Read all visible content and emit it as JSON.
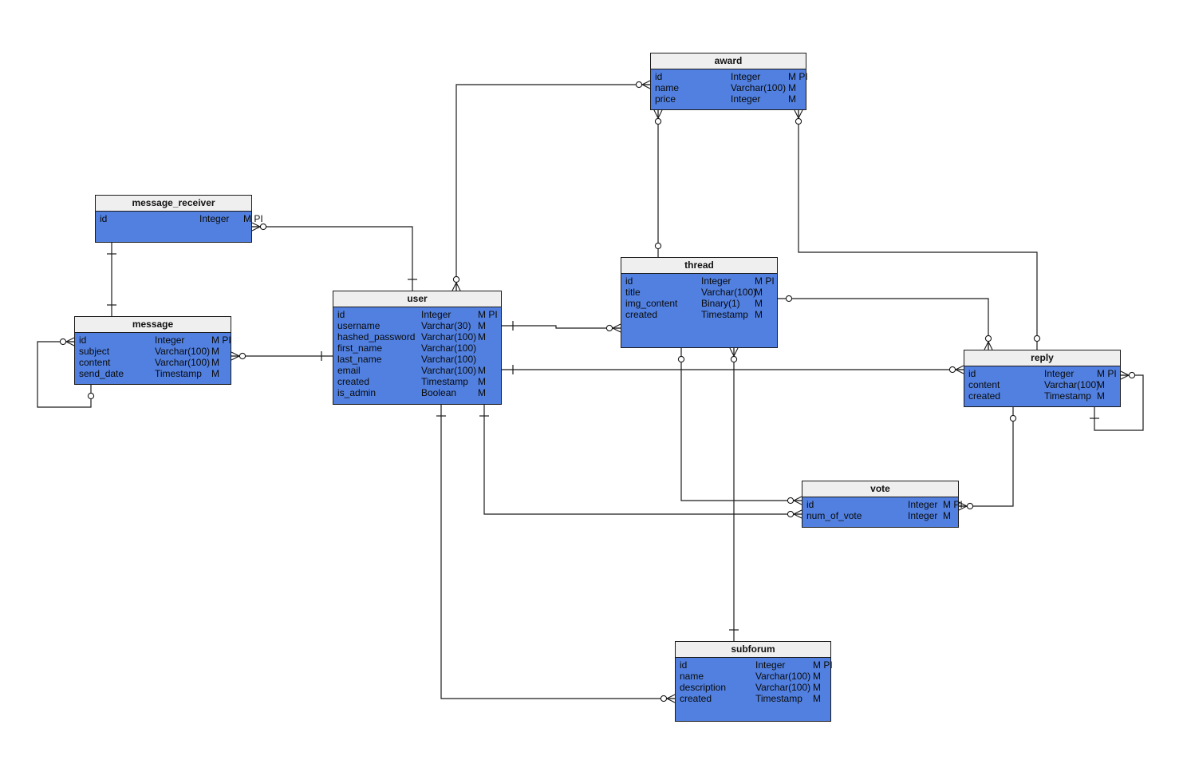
{
  "diagram_type": "entity-relationship",
  "colors": {
    "entity_body": "#5180e0",
    "entity_header": "#efefef",
    "line": "#1a1a1a"
  },
  "entities": {
    "award": {
      "name": "award",
      "attributes": [
        {
          "name": "id",
          "type": "Integer",
          "flags": "M PI"
        },
        {
          "name": "name",
          "type": "Varchar(100)",
          "flags": "M"
        },
        {
          "name": "price",
          "type": "Integer",
          "flags": "M"
        }
      ]
    },
    "message_receiver": {
      "name": "message_receiver",
      "attributes": [
        {
          "name": "id",
          "type": "Integer",
          "flags": "M PI"
        }
      ]
    },
    "message": {
      "name": "message",
      "attributes": [
        {
          "name": "id",
          "type": "Integer",
          "flags": "M PI"
        },
        {
          "name": "subject",
          "type": "Varchar(100)",
          "flags": "M"
        },
        {
          "name": "content",
          "type": "Varchar(100)",
          "flags": "M"
        },
        {
          "name": "send_date",
          "type": "Timestamp",
          "flags": "M"
        }
      ]
    },
    "user": {
      "name": "user",
      "attributes": [
        {
          "name": "id",
          "type": "Integer",
          "flags": "M PI"
        },
        {
          "name": "username",
          "type": "Varchar(30)",
          "flags": "M"
        },
        {
          "name": "hashed_password",
          "type": "Varchar(100)",
          "flags": "M"
        },
        {
          "name": "first_name",
          "type": "Varchar(100)",
          "flags": ""
        },
        {
          "name": "last_name",
          "type": "Varchar(100)",
          "flags": ""
        },
        {
          "name": "email",
          "type": "Varchar(100)",
          "flags": "M"
        },
        {
          "name": "created",
          "type": "Timestamp",
          "flags": "M"
        },
        {
          "name": "is_admin",
          "type": "Boolean",
          "flags": "M"
        }
      ]
    },
    "thread": {
      "name": "thread",
      "attributes": [
        {
          "name": "id",
          "type": "Integer",
          "flags": "M PI"
        },
        {
          "name": "title",
          "type": "Varchar(100)",
          "flags": "M"
        },
        {
          "name": "img_content",
          "type": "Binary(1)",
          "flags": "M"
        },
        {
          "name": "created",
          "type": "Timestamp",
          "flags": "M"
        }
      ]
    },
    "reply": {
      "name": "reply",
      "attributes": [
        {
          "name": "id",
          "type": "Integer",
          "flags": "M PI"
        },
        {
          "name": "content",
          "type": "Varchar(100)",
          "flags": "M"
        },
        {
          "name": "created",
          "type": "Timestamp",
          "flags": "M"
        }
      ]
    },
    "vote": {
      "name": "vote",
      "attributes": [
        {
          "name": "id",
          "type": "Integer",
          "flags": "M PI"
        },
        {
          "name": "num_of_vote",
          "type": "Integer",
          "flags": "M"
        }
      ]
    },
    "subforum": {
      "name": "subforum",
      "attributes": [
        {
          "name": "id",
          "type": "Integer",
          "flags": "M PI"
        },
        {
          "name": "name",
          "type": "Varchar(100)",
          "flags": "M"
        },
        {
          "name": "description",
          "type": "Varchar(100)",
          "flags": "M"
        },
        {
          "name": "created",
          "type": "Timestamp",
          "flags": "M"
        }
      ]
    }
  },
  "relationships": [
    {
      "from": "user",
      "to": "award",
      "from_cardinality": "zero-or-many",
      "to_cardinality": "zero-or-many"
    },
    {
      "from": "award",
      "to": "thread",
      "from_cardinality": "zero-or-many",
      "to_cardinality": "zero-or-one"
    },
    {
      "from": "award",
      "to": "reply",
      "from_cardinality": "zero-or-many",
      "to_cardinality": "zero-or-one"
    },
    {
      "from": "message_receiver",
      "to": "user",
      "from_cardinality": "zero-or-many",
      "to_cardinality": "one"
    },
    {
      "from": "message_receiver",
      "to": "message",
      "from_cardinality": "one",
      "to_cardinality": "one"
    },
    {
      "from": "message",
      "to": "message",
      "from_cardinality": "zero-or-many",
      "to_cardinality": "zero-or-one"
    },
    {
      "from": "message",
      "to": "user",
      "from_cardinality": "zero-or-many",
      "to_cardinality": "one"
    },
    {
      "from": "user",
      "to": "thread",
      "from_cardinality": "one",
      "to_cardinality": "zero-or-many"
    },
    {
      "from": "user",
      "to": "reply",
      "from_cardinality": "one",
      "to_cardinality": "zero-or-many"
    },
    {
      "from": "thread",
      "to": "reply",
      "from_cardinality": "zero-or-one",
      "to_cardinality": "zero-or-many"
    },
    {
      "from": "thread",
      "to": "vote",
      "from_cardinality": "zero-or-one",
      "to_cardinality": "zero-or-many"
    },
    {
      "from": "thread",
      "to": "subforum",
      "from_cardinality": "zero-or-many",
      "to_cardinality": "one"
    },
    {
      "from": "user",
      "to": "vote",
      "from_cardinality": "one",
      "to_cardinality": "zero-or-many"
    },
    {
      "from": "user",
      "to": "subforum",
      "from_cardinality": "one",
      "to_cardinality": "zero-or-many"
    },
    {
      "from": "reply",
      "to": "vote",
      "from_cardinality": "zero-or-one",
      "to_cardinality": "zero-or-many"
    },
    {
      "from": "reply",
      "to": "reply",
      "from_cardinality": "zero-or-many",
      "to_cardinality": "one"
    }
  ]
}
